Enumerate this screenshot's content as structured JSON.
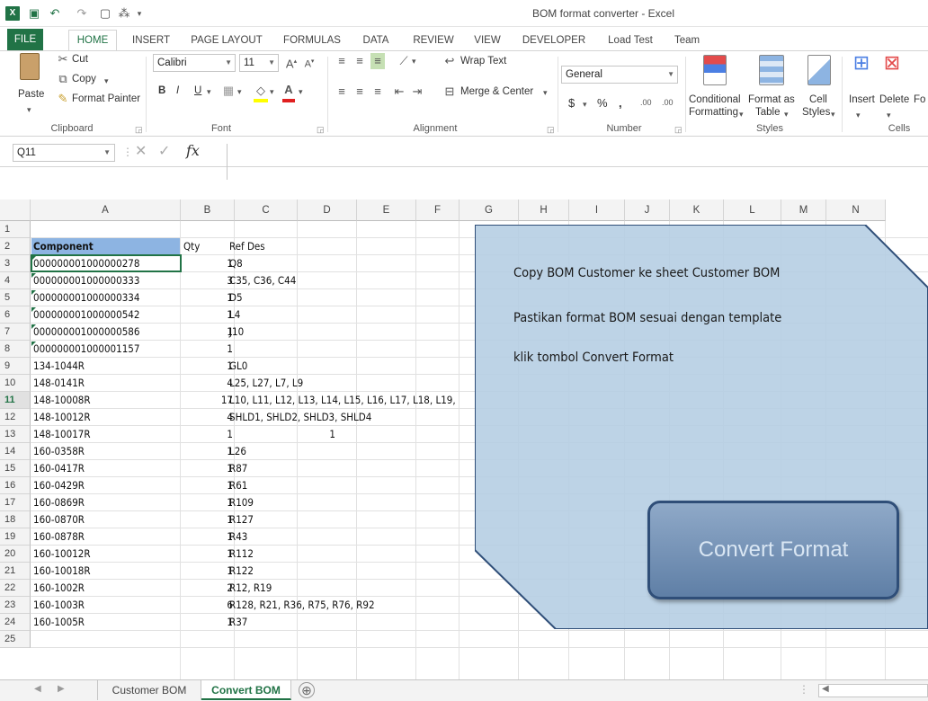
{
  "window": {
    "title": "BOM format converter - Excel"
  },
  "ribbon_tabs": [
    "FILE",
    "HOME",
    "INSERT",
    "PAGE LAYOUT",
    "FORMULAS",
    "DATA",
    "REVIEW",
    "VIEW",
    "DEVELOPER",
    "Load Test",
    "Team"
  ],
  "clipboard": {
    "paste": "Paste",
    "cut": "Cut",
    "copy": "Copy",
    "format_painter": "Format Painter",
    "label": "Clipboard"
  },
  "font": {
    "name": "Calibri",
    "size": "11",
    "label": "Font",
    "bold": "B",
    "italic": "I",
    "underline": "U"
  },
  "alignment": {
    "wrap": "Wrap Text",
    "merge": "Merge & Center",
    "label": "Alignment"
  },
  "number": {
    "format": "General",
    "currency": "$",
    "percent": "%",
    "comma": ",",
    "inc_dec": ".00",
    "label": "Number"
  },
  "styles": {
    "conditional": "Conditional",
    "conditional2": "Formatting",
    "format_as": "Format as",
    "format_as2": "Table",
    "cell": "Cell",
    "cell2": "Styles",
    "label": "Styles"
  },
  "cells": {
    "insert": "Insert",
    "delete": "Delete",
    "format": "Fo",
    "label": "Cells"
  },
  "formula_bar": {
    "name_box": "Q11",
    "fx": "fx",
    "value": ""
  },
  "columns": [
    "A",
    "B",
    "C",
    "D",
    "E",
    "F",
    "G",
    "H",
    "I",
    "J",
    "K",
    "L",
    "M",
    "N"
  ],
  "rows": [
    "1",
    "2",
    "3",
    "4",
    "5",
    "6",
    "7",
    "8",
    "9",
    "10",
    "11",
    "12",
    "13",
    "14",
    "15",
    "16",
    "17",
    "18",
    "19",
    "20",
    "21",
    "22",
    "23",
    "24",
    "25"
  ],
  "selected_row": "11",
  "headers": {
    "component": "Component",
    "qty": "Qty",
    "ref": "Ref Des"
  },
  "data_rows": [
    {
      "component": "000000001000000278",
      "qty": "1",
      "ref": "Q8"
    },
    {
      "component": "000000001000000333",
      "qty": "3",
      "ref": "C35, C36, C44"
    },
    {
      "component": "000000001000000334",
      "qty": "1",
      "ref": "D5"
    },
    {
      "component": "000000001000000542",
      "qty": "1",
      "ref": "L4"
    },
    {
      "component": "000000001000000586",
      "qty": "1",
      "ref": "J10"
    },
    {
      "component": "000000001000001157",
      "qty": "1",
      "ref": ""
    },
    {
      "component": "134-1044R",
      "qty": "1",
      "ref": "GL0"
    },
    {
      "component": "148-0141R",
      "qty": "4",
      "ref": "L25, L27, L7, L9"
    },
    {
      "component": "148-10008R",
      "qty": "17",
      "ref": "L10, L11, L12, L13, L14, L15, L16, L17, L18, L19,"
    },
    {
      "component": "148-10012R",
      "qty": "4",
      "ref": "SHLD1, SHLD2, SHLD3, SHLD4"
    },
    {
      "component": "148-10017R",
      "qty": "1",
      "ref": ""
    },
    {
      "component": "160-0358R",
      "qty": "1",
      "ref": "L26"
    },
    {
      "component": "160-0417R",
      "qty": "1",
      "ref": "R87"
    },
    {
      "component": "160-0429R",
      "qty": "1",
      "ref": "R61"
    },
    {
      "component": "160-0869R",
      "qty": "1",
      "ref": "R109"
    },
    {
      "component": "160-0870R",
      "qty": "1",
      "ref": "R127"
    },
    {
      "component": "160-0878R",
      "qty": "1",
      "ref": "R43"
    },
    {
      "component": "160-10012R",
      "qty": "1",
      "ref": "R112"
    },
    {
      "component": "160-10018R",
      "qty": "1",
      "ref": "R122"
    },
    {
      "component": "160-1002R",
      "qty": "2",
      "ref": "R12, R19"
    },
    {
      "component": "160-1003R",
      "qty": "6",
      "ref": "R128, R21, R36, R75, R76, R92"
    },
    {
      "component": "160-1005R",
      "qty": "1",
      "ref": "R37"
    }
  ],
  "row13_d_value": "1",
  "instructions": [
    "Copy BOM Customer ke sheet Customer BOM",
    "Pastikan format BOM sesuai dengan template",
    "klik tombol Convert Format"
  ],
  "convert_button": "Convert Format",
  "sheets": [
    "Customer BOM",
    "Convert BOM"
  ],
  "active_sheet": "Convert BOM",
  "add_sheet": "⊕"
}
